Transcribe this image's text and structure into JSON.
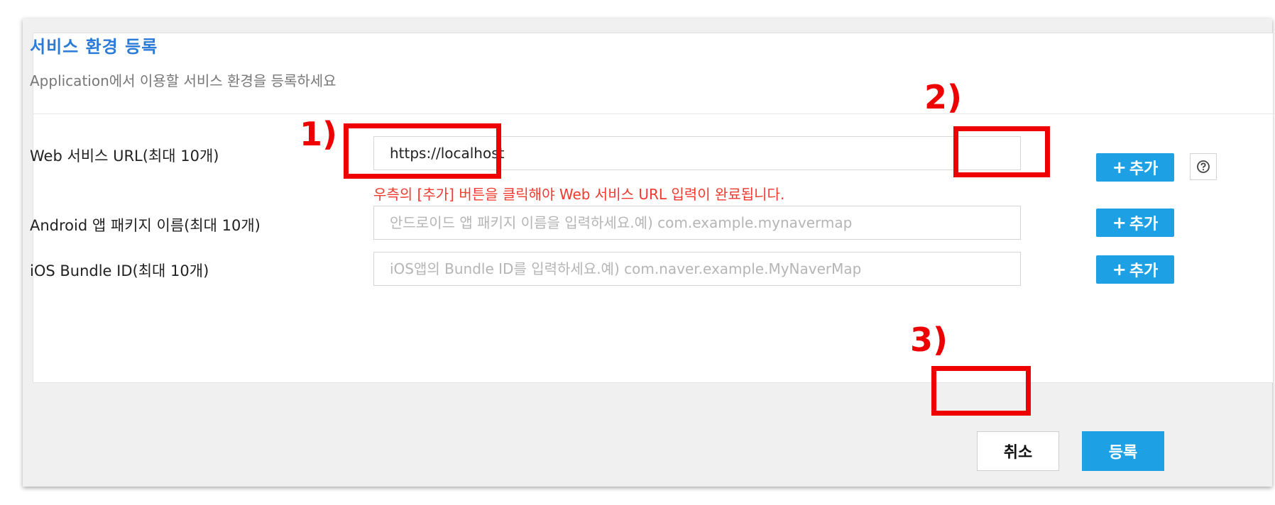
{
  "header": {
    "title": "서비스 환경 등록",
    "subtitle": "Application에서 이용할 서비스 환경을 등록하세요"
  },
  "rows": [
    {
      "label": "Web 서비스 URL(최대 10개)",
      "value": "https://localhost",
      "placeholder": "",
      "add_label": "추가"
    },
    {
      "label": "Android 앱 패키지 이름(최대 10개)",
      "value": "",
      "placeholder": "안드로이드 앱 패키지 이름을 입력하세요.예) com.example.mynavermap",
      "add_label": "추가"
    },
    {
      "label": "iOS Bundle ID(최대 10개)",
      "value": "",
      "placeholder": "iOS앱의 Bundle ID를 입력하세요.예) com.naver.example.MyNaverMap",
      "add_label": "추가"
    }
  ],
  "web_warning": "우측의 [추가] 버튼을 클릭해야 Web 서비스 URL 입력이 완료됩니다.",
  "footer": {
    "cancel_label": "취소",
    "submit_label": "등록"
  },
  "annotations": {
    "step1": "1)",
    "step2": "2)",
    "step3": "3)"
  },
  "colors": {
    "accent": "#1da1e4",
    "title": "#2a7ad8",
    "warning": "#f0392f",
    "annotation": "#ee0000"
  },
  "icons": {
    "add": "plus-icon",
    "help": "question-circle-icon"
  }
}
